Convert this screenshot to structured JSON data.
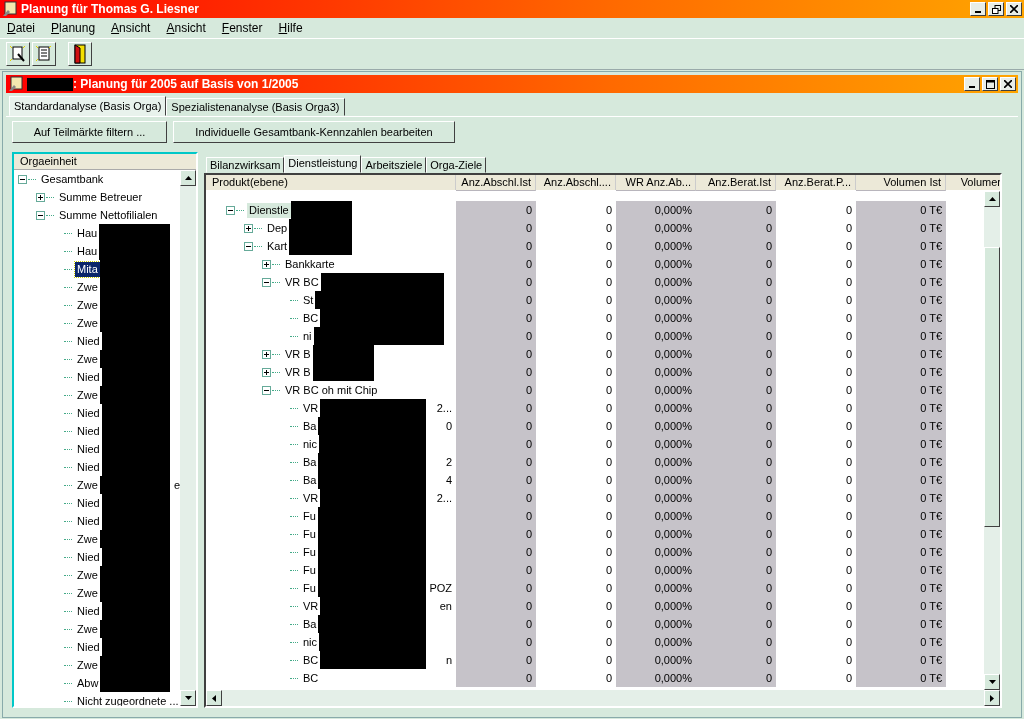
{
  "window": {
    "title": "Planung für Thomas G. Liesner"
  },
  "menu": [
    "Datei",
    "Planung",
    "Ansicht",
    "Ansicht",
    "Fenster",
    "Hilfe"
  ],
  "document": {
    "title": ": Planung für 2005 auf Basis von 1/2005",
    "tabs": [
      {
        "label": "Standardanalyse (Basis Orga)",
        "selected": true
      },
      {
        "label": "Spezialistenanalyse (Basis Orga3)",
        "selected": false
      }
    ],
    "buttons": [
      "Auf Teilmärkte filtern ...",
      "Individuelle Gesamtbank-Kennzahlen bearbeiten"
    ],
    "org_tree": {
      "header": "Orgaeinheit",
      "items": [
        {
          "label": "Gesamtbank",
          "expanded": true,
          "selected": false,
          "children": [
            {
              "label": "Summe Betreuer",
              "expanded": false,
              "selected": false
            },
            {
              "label": "Summe Nettofilialen",
              "expanded": true,
              "selected": false,
              "children": [
                {
                  "label": "Hau",
                  "selected": false
                },
                {
                  "label": "Hau",
                  "selected": false
                },
                {
                  "label": "Mita",
                  "selected": true
                },
                {
                  "label": "Zwe",
                  "selected": false
                },
                {
                  "label": "Zwe",
                  "selected": false
                },
                {
                  "label": "Zwe",
                  "selected": false
                },
                {
                  "label": "Nied",
                  "selected": false
                },
                {
                  "label": "Zwe",
                  "selected": false
                },
                {
                  "label": "Nied",
                  "selected": false
                },
                {
                  "label": "Zwe",
                  "selected": false
                },
                {
                  "label": "Nied",
                  "selected": false
                },
                {
                  "label": "Nied",
                  "selected": false
                },
                {
                  "label": "Nied",
                  "selected": false
                },
                {
                  "label": "Nied",
                  "selected": false
                },
                {
                  "label": "Zwe",
                  "tail": "e",
                  "selected": false
                },
                {
                  "label": "Nied",
                  "selected": false
                },
                {
                  "label": "Nied",
                  "selected": false
                },
                {
                  "label": "Zwe",
                  "selected": false
                },
                {
                  "label": "Nied",
                  "selected": false
                },
                {
                  "label": "Zwe",
                  "selected": false
                },
                {
                  "label": "Zwe",
                  "selected": false
                },
                {
                  "label": "Nied",
                  "selected": false
                },
                {
                  "label": "Zwe",
                  "selected": false
                },
                {
                  "label": "Nied",
                  "selected": false
                },
                {
                  "label": "Zwe",
                  "selected": false
                },
                {
                  "label": "Abw",
                  "selected": false
                },
                {
                  "label": "Nicht zugeordnete ...",
                  "selected": false
                }
              ]
            }
          ]
        }
      ]
    },
    "product_tabs": [
      {
        "label": "Bilanzwirksam",
        "selected": false
      },
      {
        "label": "Dienstleistung",
        "selected": true
      },
      {
        "label": "Arbeitsziele",
        "selected": false
      },
      {
        "label": "Orga-Ziele",
        "selected": false
      }
    ],
    "table": {
      "columns": [
        {
          "label": "Produkt(ebene)",
          "readonly": false
        },
        {
          "label": "Anz.Abschl.Ist",
          "readonly": true
        },
        {
          "label": "Anz.Abschl....",
          "readonly": false
        },
        {
          "label": "WR Anz.Ab...",
          "readonly": true
        },
        {
          "label": "Anz.Berat.Ist",
          "readonly": true
        },
        {
          "label": "Anz.Berat.P...",
          "readonly": false
        },
        {
          "label": "Volumen Ist",
          "readonly": true
        },
        {
          "label": "Volumer",
          "readonly": false
        }
      ],
      "rows": [
        {
          "label": "Dienstle",
          "expanded": true,
          "selected": true,
          "values": [
            "0",
            "0",
            "0,000%",
            "0",
            "0",
            "0 T€"
          ],
          "children": [
            {
              "label": "Dep",
              "expanded": false,
              "selected": false,
              "values": [
                "0",
                "0",
                "0,000%",
                "0",
                "0",
                "0 T€"
              ]
            },
            {
              "label": "Kart",
              "expanded": true,
              "selected": false,
              "values": [
                "0",
                "0",
                "0,000%",
                "0",
                "0",
                "0 T€"
              ],
              "children": [
                {
                  "label": "Bankkarte",
                  "expanded": false,
                  "selected": false,
                  "values": [
                    "0",
                    "0",
                    "0,000%",
                    "0",
                    "0",
                    "0 T€"
                  ]
                },
                {
                  "label": "VR BC",
                  "expanded": true,
                  "selected": false,
                  "values": [
                    "0",
                    "0",
                    "0,000%",
                    "0",
                    "0",
                    "0 T€"
                  ],
                  "children": [
                    {
                      "label": "St",
                      "selected": false,
                      "values": [
                        "0",
                        "0",
                        "0,000%",
                        "0",
                        "0",
                        "0 T€"
                      ]
                    },
                    {
                      "label": "BC",
                      "selected": false,
                      "values": [
                        "0",
                        "0",
                        "0,000%",
                        "0",
                        "0",
                        "0 T€"
                      ]
                    },
                    {
                      "label": "ni",
                      "selected": false,
                      "values": [
                        "0",
                        "0",
                        "0,000%",
                        "0",
                        "0",
                        "0 T€"
                      ]
                    }
                  ]
                },
                {
                  "label": "VR B",
                  "expanded": false,
                  "selected": false,
                  "values": [
                    "0",
                    "0",
                    "0,000%",
                    "0",
                    "0",
                    "0 T€"
                  ]
                },
                {
                  "label": "VR B",
                  "expanded": false,
                  "selected": false,
                  "values": [
                    "0",
                    "0",
                    "0,000%",
                    "0",
                    "0",
                    "0 T€"
                  ]
                },
                {
                  "label": "VR BC oh mit Chip",
                  "expanded": true,
                  "selected": false,
                  "values": [
                    "0",
                    "0",
                    "0,000%",
                    "0",
                    "0",
                    "0 T€"
                  ],
                  "children": [
                    {
                      "label": "VR",
                      "tail": "2...",
                      "selected": false,
                      "values": [
                        "0",
                        "0",
                        "0,000%",
                        "0",
                        "0",
                        "0 T€"
                      ]
                    },
                    {
                      "label": "Ba",
                      "tail": "0",
                      "selected": false,
                      "values": [
                        "0",
                        "0",
                        "0,000%",
                        "0",
                        "0",
                        "0 T€"
                      ]
                    },
                    {
                      "label": "nic",
                      "selected": false,
                      "values": [
                        "0",
                        "0",
                        "0,000%",
                        "0",
                        "0",
                        "0 T€"
                      ]
                    },
                    {
                      "label": "Ba",
                      "tail": "2",
                      "selected": false,
                      "values": [
                        "0",
                        "0",
                        "0,000%",
                        "0",
                        "0",
                        "0 T€"
                      ]
                    },
                    {
                      "label": "Ba",
                      "tail": "4",
                      "selected": false,
                      "values": [
                        "0",
                        "0",
                        "0,000%",
                        "0",
                        "0",
                        "0 T€"
                      ]
                    },
                    {
                      "label": "VR",
                      "tail": "2...",
                      "selected": false,
                      "values": [
                        "0",
                        "0",
                        "0,000%",
                        "0",
                        "0",
                        "0 T€"
                      ]
                    },
                    {
                      "label": "Fu",
                      "selected": false,
                      "values": [
                        "0",
                        "0",
                        "0,000%",
                        "0",
                        "0",
                        "0 T€"
                      ]
                    },
                    {
                      "label": "Fu",
                      "selected": false,
                      "values": [
                        "0",
                        "0",
                        "0,000%",
                        "0",
                        "0",
                        "0 T€"
                      ]
                    },
                    {
                      "label": "Fu",
                      "selected": false,
                      "values": [
                        "0",
                        "0",
                        "0,000%",
                        "0",
                        "0",
                        "0 T€"
                      ]
                    },
                    {
                      "label": "Fu",
                      "selected": false,
                      "values": [
                        "0",
                        "0",
                        "0,000%",
                        "0",
                        "0",
                        "0 T€"
                      ]
                    },
                    {
                      "label": "Fu",
                      "tail": "POZ",
                      "selected": false,
                      "values": [
                        "0",
                        "0",
                        "0,000%",
                        "0",
                        "0",
                        "0 T€"
                      ]
                    },
                    {
                      "label": "VR",
                      "tail": "en",
                      "selected": false,
                      "values": [
                        "0",
                        "0",
                        "0,000%",
                        "0",
                        "0",
                        "0 T€"
                      ]
                    },
                    {
                      "label": "Ba",
                      "selected": false,
                      "values": [
                        "0",
                        "0",
                        "0,000%",
                        "0",
                        "0",
                        "0 T€"
                      ]
                    },
                    {
                      "label": "nic",
                      "selected": false,
                      "values": [
                        "0",
                        "0",
                        "0,000%",
                        "0",
                        "0",
                        "0 T€"
                      ]
                    },
                    {
                      "label": "BC",
                      "tail": "n",
                      "selected": false,
                      "values": [
                        "0",
                        "0",
                        "0,000%",
                        "0",
                        "0",
                        "0 T€"
                      ]
                    },
                    {
                      "label": "BC",
                      "selected": false,
                      "values": [
                        "0",
                        "0",
                        "0,000%",
                        "0",
                        "0",
                        "0 T€"
                      ]
                    }
                  ]
                }
              ]
            }
          ]
        }
      ]
    }
  }
}
